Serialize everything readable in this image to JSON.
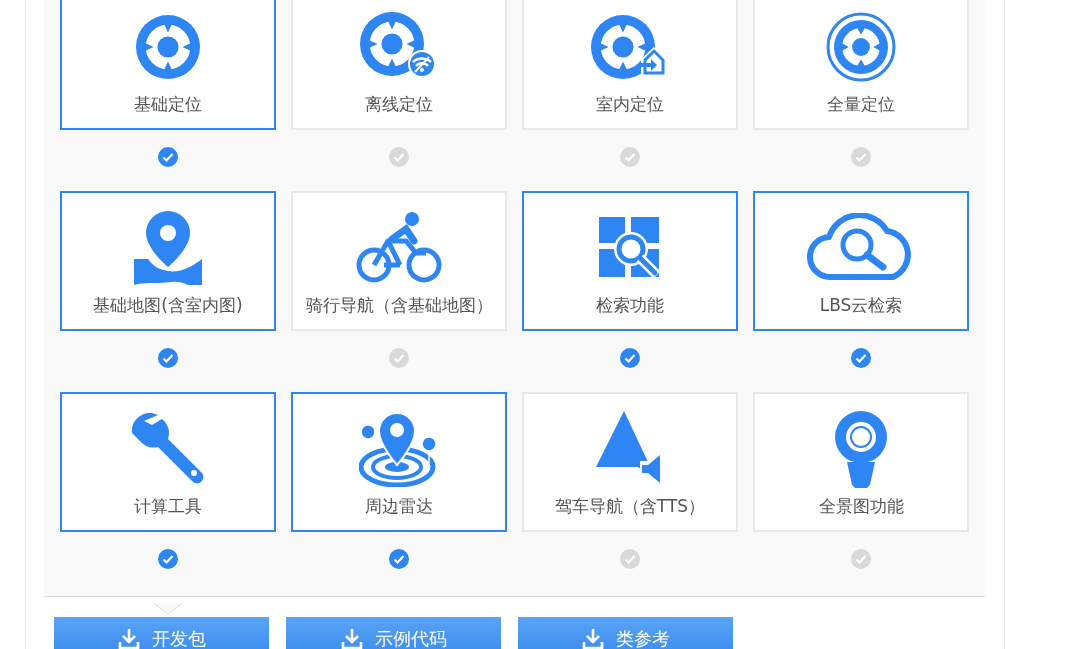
{
  "features": [
    {
      "label": "基础定位",
      "kind": "locate",
      "selected": true
    },
    {
      "label": "离线定位",
      "kind": "offline",
      "selected": false
    },
    {
      "label": "室内定位",
      "kind": "indoor",
      "selected": false
    },
    {
      "label": "全量定位",
      "kind": "full",
      "selected": false
    },
    {
      "label": "基础地图(含室内图)",
      "kind": "map",
      "selected": true
    },
    {
      "label": "骑行导航（含基础地图）",
      "kind": "cycling",
      "selected": false
    },
    {
      "label": "检索功能",
      "kind": "search",
      "selected": true
    },
    {
      "label": "LBS云检索",
      "kind": "cloud",
      "selected": true
    },
    {
      "label": "计算工具",
      "kind": "tool",
      "selected": true
    },
    {
      "label": "周边雷达",
      "kind": "radar",
      "selected": true
    },
    {
      "label": "驾车导航（含TTS）",
      "kind": "drive",
      "selected": false
    },
    {
      "label": "全景图功能",
      "kind": "panorama",
      "selected": false
    }
  ],
  "downloads": [
    {
      "label": "开发包",
      "selected": true
    },
    {
      "label": "示例代码",
      "selected": false
    },
    {
      "label": "类参考",
      "selected": false
    }
  ]
}
